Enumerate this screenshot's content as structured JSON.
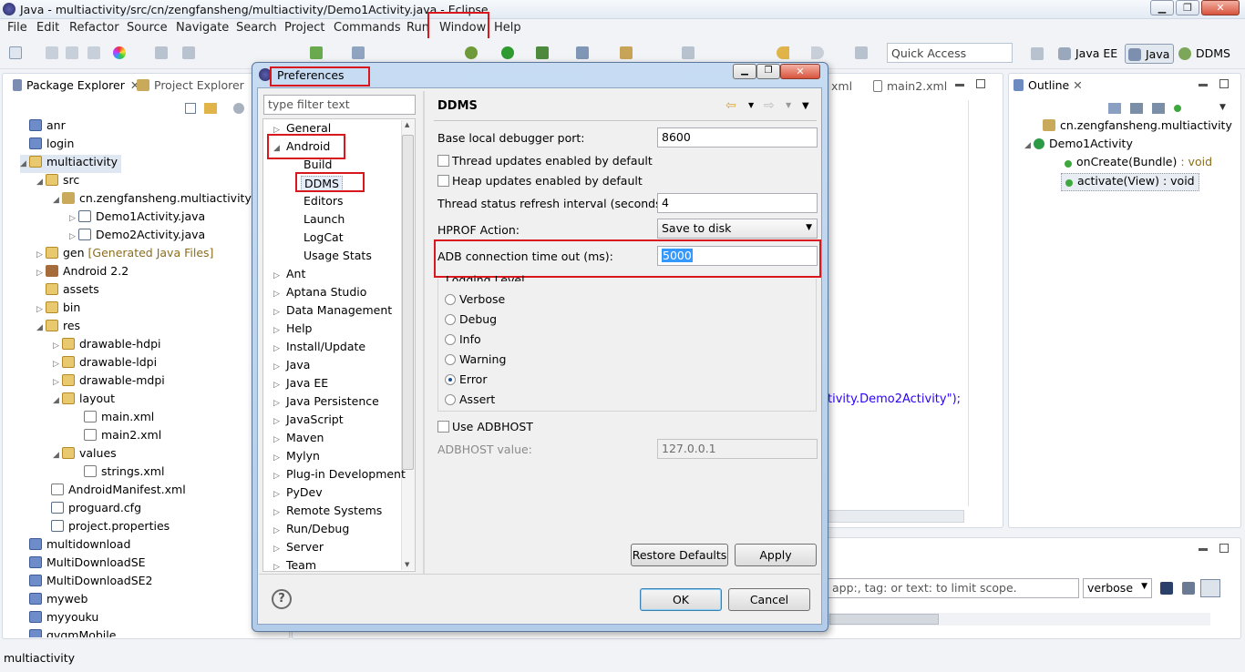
{
  "window": {
    "title": "Java - multiactivity/src/cn/zengfansheng/multiactivity/Demo1Activity.java - Eclipse",
    "min": "▁",
    "max": "❐",
    "close": "✕"
  },
  "menu": [
    "File",
    "Edit",
    "Refactor",
    "Source",
    "Navigate",
    "Search",
    "Project",
    "Commands",
    "Run",
    "Window",
    "Help"
  ],
  "toolbar": {
    "quick_access_placeholder": "Quick Access",
    "perspectives": [
      "Java EE",
      "Java",
      "DDMS"
    ]
  },
  "package_explorer": {
    "tab1": "Package Explorer",
    "tab2": "Project Explorer",
    "rows": [
      {
        "label": "anr",
        "extra": ""
      },
      {
        "label": "login",
        "extra": ""
      },
      {
        "label": "multiactivity",
        "extra": ""
      },
      {
        "label": "src",
        "extra": ""
      },
      {
        "label": "cn.zengfansheng.multiactivity",
        "extra": ""
      },
      {
        "label": "Demo1Activity.java",
        "extra": ""
      },
      {
        "label": "Demo2Activity.java",
        "extra": ""
      },
      {
        "label": "gen",
        "extra": "[Generated Java Files]"
      },
      {
        "label": "Android 2.2",
        "extra": ""
      },
      {
        "label": "assets",
        "extra": ""
      },
      {
        "label": "bin",
        "extra": ""
      },
      {
        "label": "res",
        "extra": ""
      },
      {
        "label": "drawable-hdpi",
        "extra": ""
      },
      {
        "label": "drawable-ldpi",
        "extra": ""
      },
      {
        "label": "drawable-mdpi",
        "extra": ""
      },
      {
        "label": "layout",
        "extra": ""
      },
      {
        "label": "main.xml",
        "extra": ""
      },
      {
        "label": "main2.xml",
        "extra": ""
      },
      {
        "label": "values",
        "extra": ""
      },
      {
        "label": "strings.xml",
        "extra": ""
      },
      {
        "label": "AndroidManifest.xml",
        "extra": ""
      },
      {
        "label": "proguard.cfg",
        "extra": ""
      },
      {
        "label": "project.properties",
        "extra": ""
      },
      {
        "label": "multidownload",
        "extra": ""
      },
      {
        "label": "MultiDownloadSE",
        "extra": ""
      },
      {
        "label": "MultiDownloadSE2",
        "extra": ""
      },
      {
        "label": "myweb",
        "extra": ""
      },
      {
        "label": "myyouku",
        "extra": ""
      },
      {
        "label": "qvqmMobile",
        "extra": ""
      }
    ]
  },
  "editor": {
    "tab_xml": "xml",
    "tab_main2": "main2.xml",
    "code_fragment": "tivity.Demo2Activity\");"
  },
  "outline": {
    "tab": "Outline",
    "rows": [
      {
        "label": "cn.zengfansheng.multiactivity",
        "type": ""
      },
      {
        "label": "Demo1Activity",
        "type": ""
      },
      {
        "label": "onCreate(Bundle)",
        "type": " : void"
      },
      {
        "label": "activate(View)",
        "type": " : void"
      }
    ]
  },
  "logcat": {
    "filter_placeholder": "app:, tag: or text: to limit scope.",
    "level": "verbose"
  },
  "status_bar": {
    "text": "multiactivity"
  },
  "dialog": {
    "title": "Preferences",
    "filter_placeholder": "type filter text",
    "tree": [
      "General",
      "Android",
      "Build",
      "DDMS",
      "Editors",
      "Launch",
      "LogCat",
      "Usage Stats",
      "Ant",
      "Aptana Studio",
      "Data Management",
      "Help",
      "Install/Update",
      "Java",
      "Java EE",
      "Java Persistence",
      "JavaScript",
      "Maven",
      "Mylyn",
      "Plug-in Development",
      "PyDev",
      "Remote Systems",
      "Run/Debug",
      "Server",
      "Team"
    ],
    "page_title": "DDMS",
    "base_port_label": "Base local debugger port:",
    "base_port_value": "8600",
    "thread_updates_label": "Thread updates enabled by default",
    "heap_updates_label": "Heap updates enabled by default",
    "thread_refresh_label": "Thread status refresh interval (seconds):",
    "thread_refresh_value": "4",
    "hprof_label": "HPROF Action:",
    "hprof_value": "Save to disk",
    "adb_timeout_label": "ADB connection time out (ms):",
    "adb_timeout_value": "5000",
    "logging_level_label": "Logging Level",
    "levels": [
      "Verbose",
      "Debug",
      "Info",
      "Warning",
      "Error",
      "Assert"
    ],
    "selected_level": "Error",
    "use_adbhost_label": "Use ADBHOST",
    "adbhost_value_label": "ADBHOST value:",
    "adbhost_value": "127.0.0.1",
    "restore_defaults": "Restore Defaults",
    "apply": "Apply",
    "ok": "OK",
    "cancel": "Cancel",
    "help_glyph": "?"
  }
}
